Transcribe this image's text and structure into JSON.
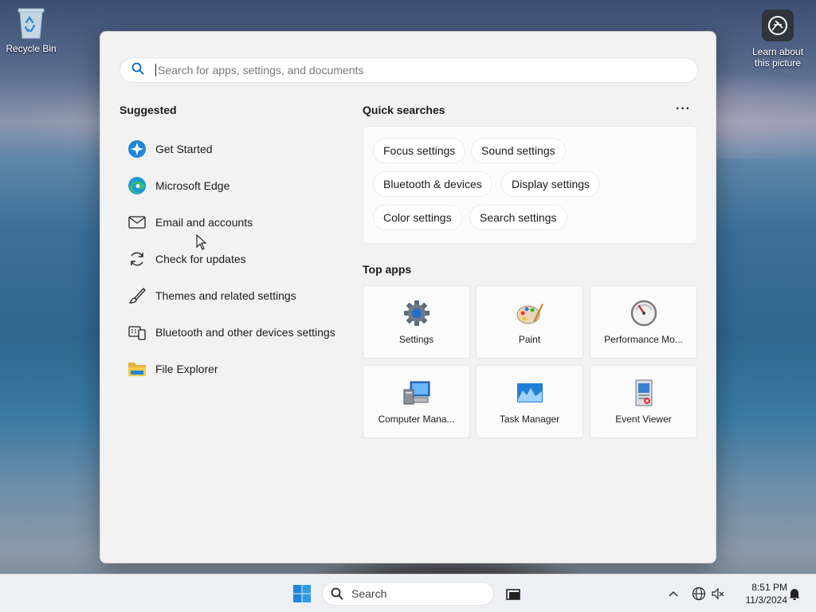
{
  "desktop": {
    "recycle_bin_label": "Recycle Bin",
    "learn_label": "Learn about this picture"
  },
  "start_menu": {
    "search_placeholder": "Search for apps, settings, and documents",
    "suggested_title": "Suggested",
    "suggested": [
      {
        "label": "Get Started",
        "icon": "get-started-icon"
      },
      {
        "label": "Microsoft Edge",
        "icon": "edge-icon"
      },
      {
        "label": "Email and accounts",
        "icon": "mail-icon"
      },
      {
        "label": "Check for updates",
        "icon": "refresh-icon"
      },
      {
        "label": "Themes and related settings",
        "icon": "brush-icon"
      },
      {
        "label": "Bluetooth and other devices settings",
        "icon": "devices-icon"
      },
      {
        "label": "File Explorer",
        "icon": "folder-icon"
      }
    ],
    "quick_searches_title": "Quick searches",
    "more_label": "···",
    "quick_searches": [
      "Focus settings",
      "Sound settings",
      "Bluetooth & devices",
      "Display settings",
      "Color settings",
      "Search settings"
    ],
    "top_apps_title": "Top apps",
    "top_apps": [
      {
        "label": "Settings",
        "icon": "gear-icon"
      },
      {
        "label": "Paint",
        "icon": "palette-icon"
      },
      {
        "label": "Performance Mo...",
        "icon": "gauge-icon"
      },
      {
        "label": "Computer Mana...",
        "icon": "computer-management-icon"
      },
      {
        "label": "Task Manager",
        "icon": "task-manager-icon"
      },
      {
        "label": "Event Viewer",
        "icon": "event-viewer-icon"
      }
    ]
  },
  "taskbar": {
    "search_label": "Search",
    "time": "8:51 PM",
    "date": "11/3/2024"
  },
  "colors": {
    "accent": "#0067c0",
    "panel_bg": "#f2f2f2",
    "taskbar_bg": "#eef0f3"
  }
}
